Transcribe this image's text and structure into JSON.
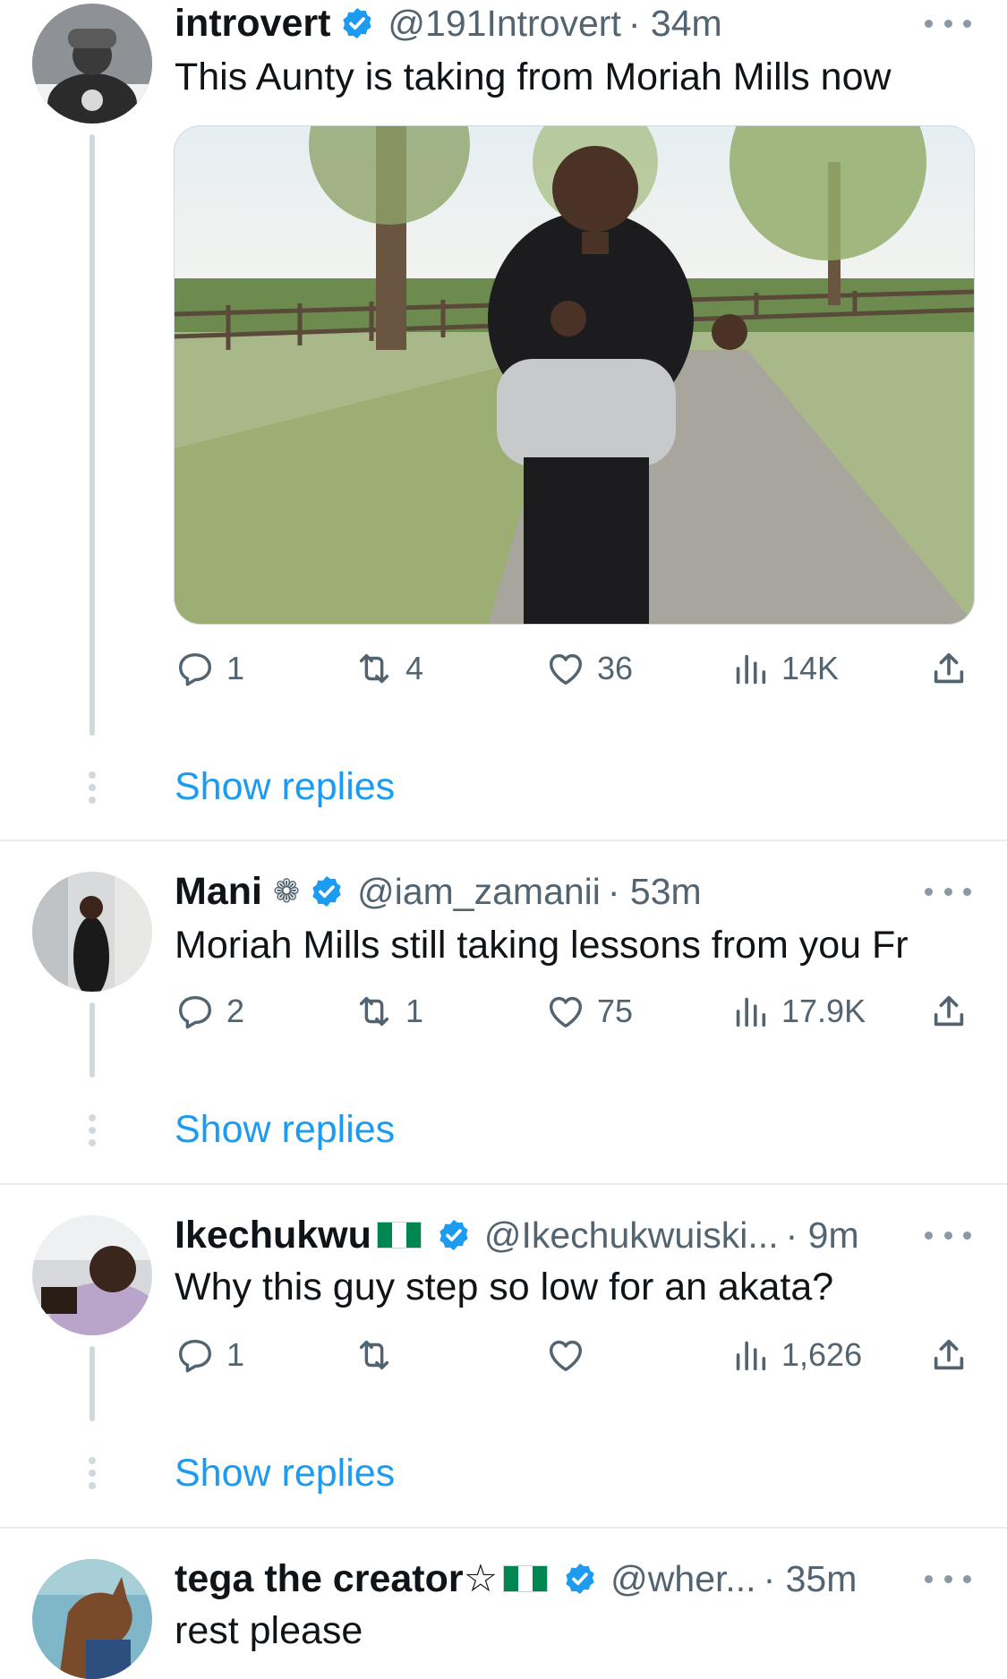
{
  "tweets": [
    {
      "name": "introvert",
      "handle": "@191Introvert",
      "time": "· 34m",
      "text": "This Aunty is taking from Moriah Mills now",
      "replies": "1",
      "retweets": "4",
      "likes": "36",
      "views": "14K",
      "show_replies": "Show replies"
    },
    {
      "name": "Mani",
      "name_symbol": "❁",
      "handle": "@iam_zamanii",
      "time": "· 53m",
      "text": "Moriah Mills still taking lessons from you  Fr",
      "replies": "2",
      "retweets": "1",
      "likes": "75",
      "views": "17.9K",
      "show_replies": "Show replies"
    },
    {
      "name": "Ikechukwu",
      "handle": "@Ikechukwuiski...",
      "time": "· 9m",
      "text": "Why this guy step so low for an akata?",
      "replies": "1",
      "retweets": "",
      "likes": "",
      "views": "1,626",
      "show_replies": "Show replies"
    },
    {
      "name": "tega the creator☆",
      "handle": "@wher...",
      "time": "· 35m",
      "text": "rest please"
    }
  ],
  "icons": [
    "verified-badge-icon",
    "more-icon",
    "reply-icon",
    "retweet-icon",
    "like-icon",
    "views-icon",
    "share-icon",
    "nigeria-flag-icon"
  ],
  "colors": {
    "link": "#1d9bf0",
    "verified": "#1d9bf0",
    "muted": "#536471",
    "thread_line": "#cfd9de"
  }
}
